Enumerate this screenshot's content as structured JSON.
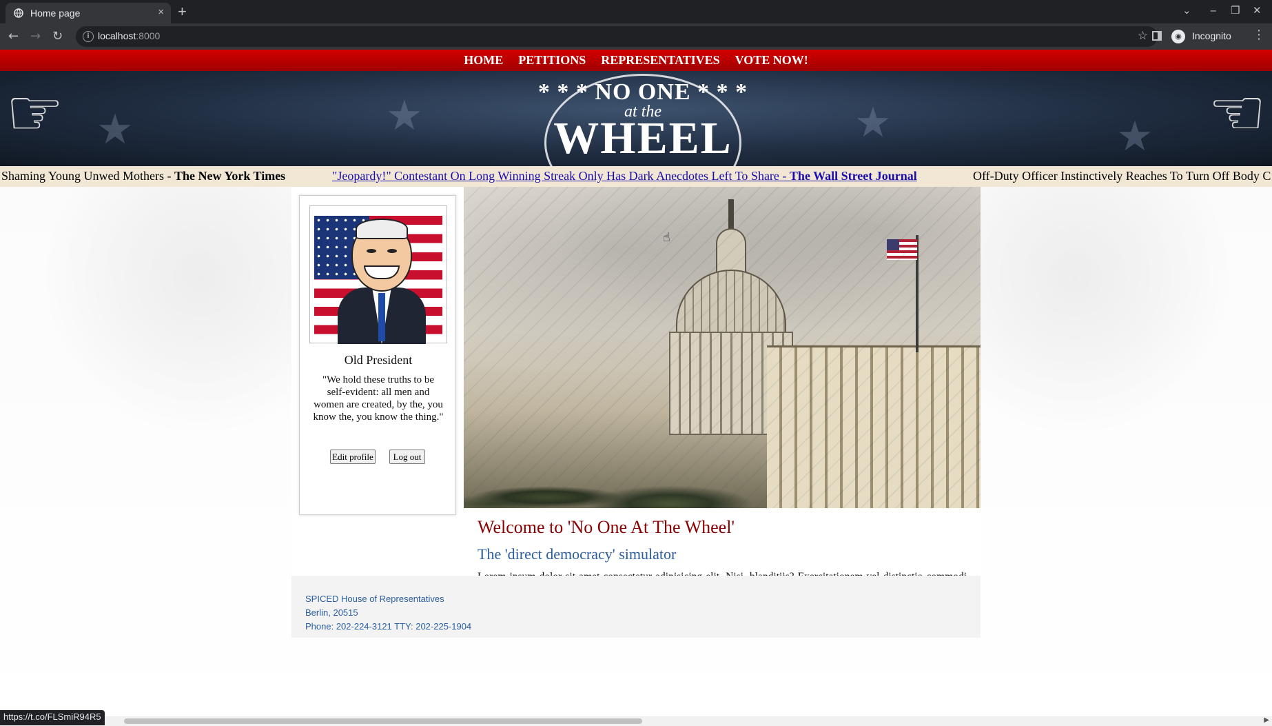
{
  "browser": {
    "tab_title": "Home page",
    "new_tab_glyph": "+",
    "close_glyph": "×",
    "url_host": "localhost",
    "url_port": ":8000",
    "profile_label": "Incognito",
    "status_url": "https://t.co/FLSmiR94R5",
    "icons": [
      "globe-icon",
      "back-arrow-icon",
      "forward-arrow-icon",
      "reload-icon",
      "info-icon",
      "star-icon",
      "side-panel-icon",
      "incognito-icon",
      "menu-dots-icon",
      "minimize-icon",
      "maximize-icon",
      "close-window-icon",
      "tab-search-icon"
    ]
  },
  "nav": {
    "items": [
      "HOME",
      "PETITIONS",
      "REPRESENTATIVES",
      "VOTE NOW!"
    ]
  },
  "logo": {
    "line1": "* * * NO ONE * * *",
    "line2": "at the",
    "line3": "WHEEL"
  },
  "ticker": {
    "items": [
      {
        "headline": "Shaming Young Unwed Mothers - ",
        "source": "The New York Times"
      },
      {
        "headline": "\"Jeopardy!\" Contestant On Long Winning Streak Only Has Dark Anecdotes Left To Share - ",
        "source": "The Wall Street Journal"
      },
      {
        "headline": "Off-Duty Officer Instinctively Reaches To Turn Off Body C",
        "source": ""
      }
    ]
  },
  "profile": {
    "name": "Old President",
    "quote": "\"We hold these truths to be self-evident: all men and women are created, by the, you know the, you know the thing.\"",
    "edit_label": "Edit profile",
    "logout_label": "Log out"
  },
  "welcome": {
    "title": "Welcome to 'No One At The Wheel'",
    "subtitle": "The 'direct democracy' simulator",
    "body": "Lorem ipsum dolor sit amet consectetur adipisicing elit. Nisi, blanditiis? Exercitationem vel distinctio commodi quam eum, repellat fuga atque corrupti ullam eligendi sapiente voluptate deserunt iure aut doloribus quae non."
  },
  "footer": {
    "line1": "SPICED House of Representatives",
    "line2": "Berlin, 20515",
    "line3": "Phone: 202-224-3121 TTY: 202-225-1904"
  },
  "colors": {
    "nav_red": "#c00000",
    "welcome_title": "#8b0000",
    "subtitle_blue": "#2a5d9f",
    "ticker_bg": "#f1e7d4"
  }
}
